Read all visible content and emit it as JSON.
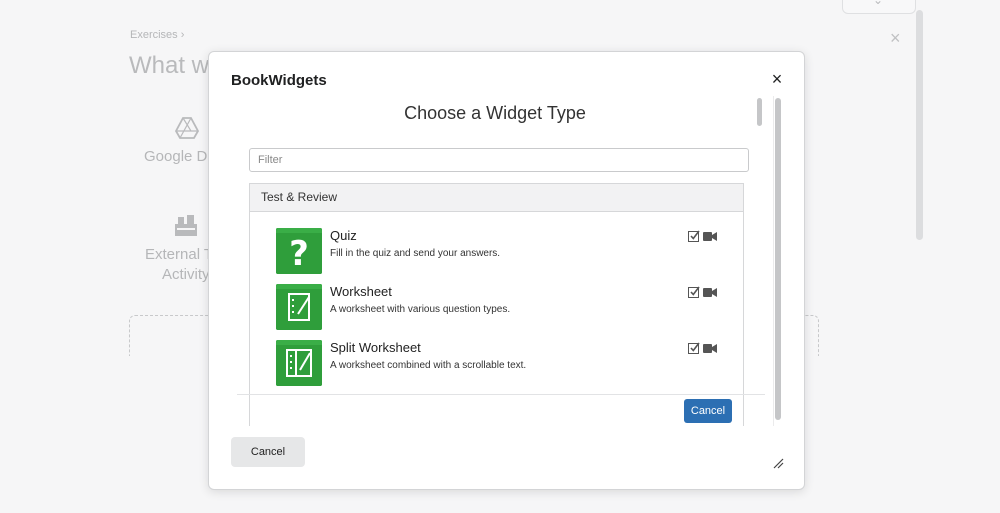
{
  "background": {
    "breadcrumb": "Exercises ›",
    "title": "What we",
    "items": [
      {
        "label": "Google Dr",
        "icon": "google-drive-icon"
      },
      {
        "label": "External T\nActivity",
        "icon": "external-tool-icon"
      }
    ]
  },
  "modal": {
    "title": "BookWidgets",
    "close_label": "×",
    "heading": "Choose a Widget Type",
    "filter_placeholder": "Filter",
    "section": "Test & Review",
    "widgets": [
      {
        "name": "Quiz",
        "description": "Fill in the quiz and send your answers.",
        "icon": "question-mark-icon"
      },
      {
        "name": "Worksheet",
        "description": "A worksheet with various question types.",
        "icon": "worksheet-icon"
      },
      {
        "name": "Split Worksheet",
        "description": "A worksheet combined with a scrollable text.",
        "icon": "split-worksheet-icon"
      }
    ],
    "inner_cancel": "Cancel",
    "outer_cancel": "Cancel"
  },
  "colors": {
    "widget_green": "#2f9e3b",
    "primary_blue": "#2c6fb3"
  }
}
